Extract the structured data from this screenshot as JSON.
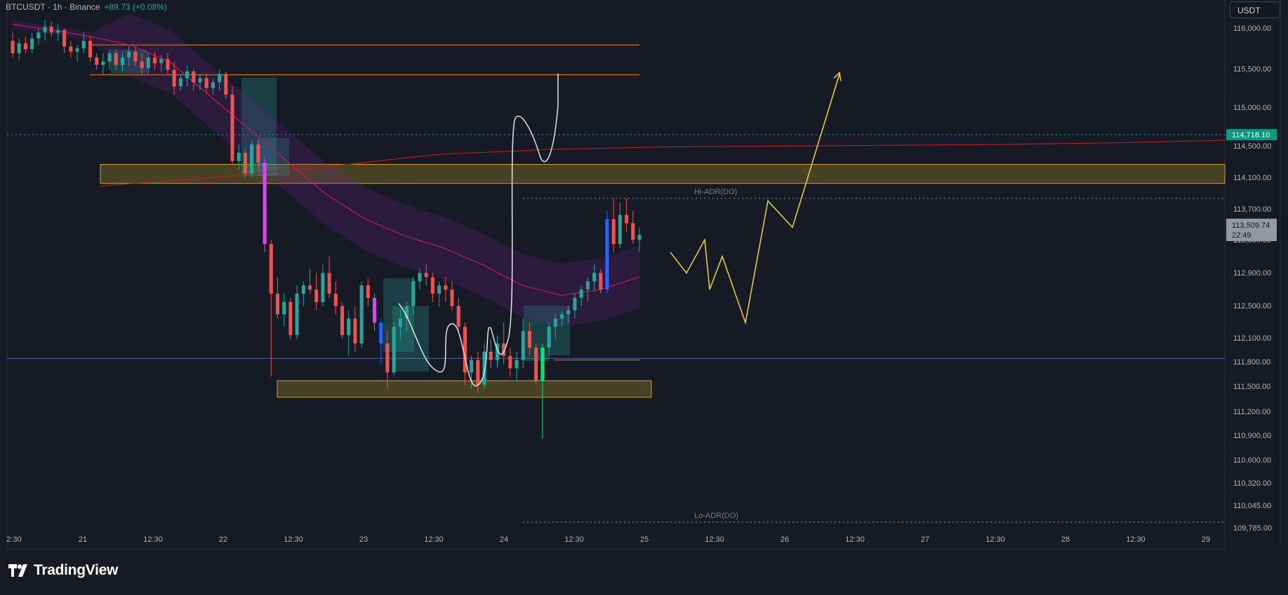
{
  "header": {
    "symbol": "BTCUSDT · 1h · Binance",
    "change": "+89.73 (+0.08%)"
  },
  "currency_button": "USDT",
  "brand": "TradingView",
  "colors": {
    "background": "#161a25",
    "up": "#26a69a",
    "down": "#ef5350",
    "grid": "#1e222d",
    "text": "#b2b5be",
    "zone_fill": "rgba(120,105,30,0.55)",
    "zone_border": "#c9a227",
    "projection": "#f0d336",
    "support_line": "#2962ff",
    "resistance_line": "#f7931a",
    "ema": "#c2185b",
    "last_price_label": "#089981",
    "current_price_label": "#b2b5be"
  },
  "chart_data": {
    "type": "candlestick",
    "symbol": "BTCUSDT",
    "timeframe": "1h",
    "exchange": "Binance",
    "y_axis": {
      "unit": "USDT",
      "ticks": [
        "116,000.00",
        "115,500.00",
        "115,000.00",
        "114,500.00",
        "114,100.00",
        "113,700.00",
        "113,300.00",
        "112,900.00",
        "112,500.00",
        "112,100.00",
        "111,800.00",
        "111,500.00",
        "111,200.00",
        "110,900.00",
        "110,600.00",
        "110,320.00",
        "110,045.00",
        "109,785.00"
      ]
    },
    "x_axis": {
      "ticks": [
        "2:30",
        "21",
        "12:30",
        "22",
        "12:30",
        "23",
        "12:30",
        "24",
        "12:30",
        "25",
        "12:30",
        "26",
        "12:30",
        "27",
        "12:30",
        "28",
        "12:30",
        "29"
      ]
    },
    "price_labels": [
      {
        "name": "prior-close",
        "value": "114,718.10"
      },
      {
        "name": "current",
        "value": "113,509.74",
        "countdown": "22:49"
      }
    ],
    "levels": [
      {
        "name": "Hi-ADR(DO)",
        "price": 113950,
        "style": "dotted"
      },
      {
        "name": "Lo-ADR(DO)",
        "price": 110045,
        "style": "dotted"
      },
      {
        "name": "support",
        "price": 112020,
        "style": "solid",
        "color": "#2962ff"
      },
      {
        "name": "resistance-upper",
        "price": 115800,
        "color": "#f7931a"
      },
      {
        "name": "resistance-lower",
        "price": 115440,
        "color": "#f7931a"
      },
      {
        "name": "prior-close",
        "price": 114718.1,
        "style": "dotted",
        "color": "#26a69a"
      }
    ],
    "zones": [
      {
        "name": "supply-zone",
        "from_price": 114130,
        "to_price": 114360
      },
      {
        "name": "demand-zone",
        "from_price": 111550,
        "to_price": 111750
      }
    ],
    "candles": [
      {
        "o": 115850,
        "h": 115950,
        "l": 115650,
        "c": 115700
      },
      {
        "o": 115700,
        "h": 115880,
        "l": 115620,
        "c": 115820
      },
      {
        "o": 115820,
        "h": 115900,
        "l": 115700,
        "c": 115750
      },
      {
        "o": 115750,
        "h": 115950,
        "l": 115700,
        "c": 115880
      },
      {
        "o": 115880,
        "h": 116000,
        "l": 115800,
        "c": 115950
      },
      {
        "o": 115950,
        "h": 116100,
        "l": 115850,
        "c": 116020
      },
      {
        "o": 116020,
        "h": 116080,
        "l": 115900,
        "c": 115950
      },
      {
        "o": 115950,
        "h": 116050,
        "l": 115850,
        "c": 115980
      },
      {
        "o": 115980,
        "h": 116000,
        "l": 115700,
        "c": 115780
      },
      {
        "o": 115780,
        "h": 115850,
        "l": 115650,
        "c": 115720
      },
      {
        "o": 115720,
        "h": 115800,
        "l": 115600,
        "c": 115760
      },
      {
        "o": 115760,
        "h": 115950,
        "l": 115700,
        "c": 115850
      },
      {
        "o": 115850,
        "h": 115900,
        "l": 115600,
        "c": 115650
      },
      {
        "o": 115650,
        "h": 115700,
        "l": 115500,
        "c": 115560
      },
      {
        "o": 115560,
        "h": 115700,
        "l": 115450,
        "c": 115600
      },
      {
        "o": 115600,
        "h": 115750,
        "l": 115500,
        "c": 115700
      },
      {
        "o": 115700,
        "h": 115750,
        "l": 115500,
        "c": 115560
      },
      {
        "o": 115560,
        "h": 115700,
        "l": 115480,
        "c": 115650
      },
      {
        "o": 115650,
        "h": 115800,
        "l": 115550,
        "c": 115720
      },
      {
        "o": 115720,
        "h": 115780,
        "l": 115550,
        "c": 115600
      },
      {
        "o": 115600,
        "h": 115700,
        "l": 115450,
        "c": 115520
      },
      {
        "o": 115520,
        "h": 115700,
        "l": 115450,
        "c": 115650
      },
      {
        "o": 115650,
        "h": 115720,
        "l": 115500,
        "c": 115580
      },
      {
        "o": 115580,
        "h": 115680,
        "l": 115480,
        "c": 115630
      },
      {
        "o": 115630,
        "h": 115700,
        "l": 115450,
        "c": 115500
      },
      {
        "o": 115500,
        "h": 115600,
        "l": 115200,
        "c": 115300
      },
      {
        "o": 115300,
        "h": 115450,
        "l": 115250,
        "c": 115400
      },
      {
        "o": 115400,
        "h": 115550,
        "l": 115300,
        "c": 115480
      },
      {
        "o": 115480,
        "h": 115520,
        "l": 115250,
        "c": 115350
      },
      {
        "o": 115350,
        "h": 115450,
        "l": 115250,
        "c": 115400
      },
      {
        "o": 115400,
        "h": 115460,
        "l": 115220,
        "c": 115280
      },
      {
        "o": 115280,
        "h": 115400,
        "l": 115200,
        "c": 115350
      },
      {
        "o": 115350,
        "h": 115500,
        "l": 115250,
        "c": 115450
      },
      {
        "o": 115450,
        "h": 115480,
        "l": 115150,
        "c": 115200
      },
      {
        "o": 115200,
        "h": 115300,
        "l": 114350,
        "c": 114400
      },
      {
        "o": 114400,
        "h": 114600,
        "l": 114300,
        "c": 114500
      },
      {
        "o": 114500,
        "h": 114550,
        "l": 114200,
        "c": 114250
      },
      {
        "o": 114250,
        "h": 114650,
        "l": 114200,
        "c": 114600
      },
      {
        "o": 114600,
        "h": 114650,
        "l": 114300,
        "c": 114380
      },
      {
        "o": 114380,
        "h": 114450,
        "l": 113300,
        "c": 113400
      },
      {
        "o": 113400,
        "h": 113450,
        "l": 111800,
        "c": 112800
      },
      {
        "o": 112800,
        "h": 113000,
        "l": 112500,
        "c": 112550
      },
      {
        "o": 112550,
        "h": 112800,
        "l": 112400,
        "c": 112700
      },
      {
        "o": 112700,
        "h": 112750,
        "l": 112250,
        "c": 112300
      },
      {
        "o": 112300,
        "h": 112900,
        "l": 112250,
        "c": 112800
      },
      {
        "o": 112800,
        "h": 112950,
        "l": 112650,
        "c": 112900
      },
      {
        "o": 112900,
        "h": 113100,
        "l": 112800,
        "c": 112850
      },
      {
        "o": 112850,
        "h": 113050,
        "l": 112600,
        "c": 112700
      },
      {
        "o": 112700,
        "h": 113150,
        "l": 112650,
        "c": 113050
      },
      {
        "o": 113050,
        "h": 113250,
        "l": 112750,
        "c": 112800
      },
      {
        "o": 112800,
        "h": 112950,
        "l": 112550,
        "c": 112650
      },
      {
        "o": 112650,
        "h": 112700,
        "l": 112250,
        "c": 112300
      },
      {
        "o": 112300,
        "h": 112600,
        "l": 112050,
        "c": 112500
      },
      {
        "o": 112500,
        "h": 112650,
        "l": 112100,
        "c": 112200
      },
      {
        "o": 112200,
        "h": 112950,
        "l": 112150,
        "c": 112900
      },
      {
        "o": 112900,
        "h": 112980,
        "l": 112650,
        "c": 112750
      },
      {
        "o": 112750,
        "h": 112800,
        "l": 112350,
        "c": 112450
      },
      {
        "o": 112450,
        "h": 112500,
        "l": 111950,
        "c": 112200
      },
      {
        "o": 112200,
        "h": 112350,
        "l": 111650,
        "c": 111850
      },
      {
        "o": 111850,
        "h": 112450,
        "l": 111800,
        "c": 112400
      },
      {
        "o": 112400,
        "h": 112600,
        "l": 112250,
        "c": 112500
      },
      {
        "o": 112500,
        "h": 112700,
        "l": 112350,
        "c": 112650
      },
      {
        "o": 112650,
        "h": 113000,
        "l": 112550,
        "c": 112950
      },
      {
        "o": 112950,
        "h": 113100,
        "l": 112850,
        "c": 113050
      },
      {
        "o": 113050,
        "h": 113150,
        "l": 112900,
        "c": 113000
      },
      {
        "o": 113000,
        "h": 113050,
        "l": 112700,
        "c": 112800
      },
      {
        "o": 112800,
        "h": 112950,
        "l": 112650,
        "c": 112900
      },
      {
        "o": 112900,
        "h": 113000,
        "l": 112700,
        "c": 112850
      },
      {
        "o": 112850,
        "h": 112950,
        "l": 112600,
        "c": 112650
      },
      {
        "o": 112650,
        "h": 112750,
        "l": 112350,
        "c": 112400
      },
      {
        "o": 112400,
        "h": 112450,
        "l": 111700,
        "c": 111850
      },
      {
        "o": 111850,
        "h": 112050,
        "l": 111650,
        "c": 112000
      },
      {
        "o": 112000,
        "h": 112100,
        "l": 111600,
        "c": 111700
      },
      {
        "o": 111700,
        "h": 112200,
        "l": 111650,
        "c": 112100
      },
      {
        "o": 112100,
        "h": 112250,
        "l": 111900,
        "c": 112000
      },
      {
        "o": 112000,
        "h": 112300,
        "l": 111900,
        "c": 112200
      },
      {
        "o": 112200,
        "h": 112450,
        "l": 111950,
        "c": 112050
      },
      {
        "o": 112050,
        "h": 112150,
        "l": 111800,
        "c": 111900
      },
      {
        "o": 111900,
        "h": 112100,
        "l": 111750,
        "c": 112000
      },
      {
        "o": 112000,
        "h": 112500,
        "l": 111900,
        "c": 112350
      },
      {
        "o": 112350,
        "h": 112450,
        "l": 112050,
        "c": 112150
      },
      {
        "o": 112150,
        "h": 112200,
        "l": 111700,
        "c": 111750
      },
      {
        "o": 111750,
        "h": 112200,
        "l": 111050,
        "c": 112150
      },
      {
        "o": 112150,
        "h": 112450,
        "l": 112050,
        "c": 112400
      },
      {
        "o": 112400,
        "h": 112550,
        "l": 112250,
        "c": 112500
      },
      {
        "o": 112500,
        "h": 112600,
        "l": 112400,
        "c": 112550
      },
      {
        "o": 112550,
        "h": 112650,
        "l": 112450,
        "c": 112600
      },
      {
        "o": 112600,
        "h": 112800,
        "l": 112500,
        "c": 112750
      },
      {
        "o": 112750,
        "h": 112900,
        "l": 112650,
        "c": 112850
      },
      {
        "o": 112850,
        "h": 113000,
        "l": 112700,
        "c": 112950
      },
      {
        "o": 112950,
        "h": 113150,
        "l": 112850,
        "c": 113050
      },
      {
        "o": 113050,
        "h": 113100,
        "l": 112800,
        "c": 112850
      },
      {
        "o": 112850,
        "h": 113800,
        "l": 112800,
        "c": 113700
      },
      {
        "o": 113700,
        "h": 113950,
        "l": 113300,
        "c": 113400
      },
      {
        "o": 113400,
        "h": 113900,
        "l": 113350,
        "c": 113750
      },
      {
        "o": 113750,
        "h": 113950,
        "l": 113550,
        "c": 113650
      },
      {
        "o": 113650,
        "h": 113800,
        "l": 113400,
        "c": 113450
      },
      {
        "o": 113450,
        "h": 113600,
        "l": 113300,
        "c": 113510
      }
    ],
    "ema_ribbon": {
      "name": "EMA",
      "values": [
        116050,
        115980,
        115900,
        115800,
        115600,
        115200,
        114800,
        114400,
        114000,
        113700,
        113500,
        113350,
        113150,
        112900,
        112780,
        112850,
        113000
      ]
    },
    "long_ma": {
      "name": "MA",
      "values": [
        114100,
        114200,
        114330,
        114480,
        114540,
        114570,
        114580,
        114590,
        114600,
        114620,
        114650
      ]
    },
    "projection": {
      "name": "projected-path",
      "prices": [
        113300,
        113050,
        113450,
        112850,
        113250,
        112450,
        113920,
        113600,
        115450
      ]
    }
  }
}
